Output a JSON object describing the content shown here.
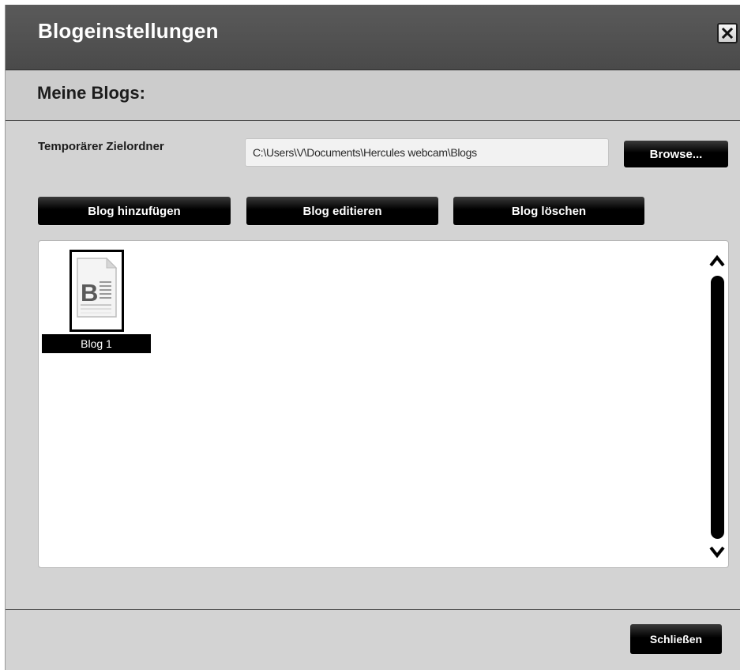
{
  "dialog": {
    "title": "Blogeinstellungen",
    "close_icon": "close-icon"
  },
  "section": {
    "heading": "Meine Blogs:"
  },
  "folder": {
    "label": "Temporärer Zielordner",
    "path": "C:\\Users\\V\\Documents\\Hercules webcam\\Blogs",
    "browse_label": "Browse..."
  },
  "actions": {
    "add_label": "Blog hinzufügen",
    "edit_label": "Blog editieren",
    "delete_label": "Blog löschen"
  },
  "blogs": [
    {
      "name": "Blog 1",
      "icon": "blog-document-icon",
      "selected": true
    }
  ],
  "footer": {
    "close_label": "Schließen"
  },
  "colors": {
    "titlebar": "#4f4f4f",
    "panel": "#d3d3d3",
    "button": "#000000",
    "selection": "#000000"
  }
}
